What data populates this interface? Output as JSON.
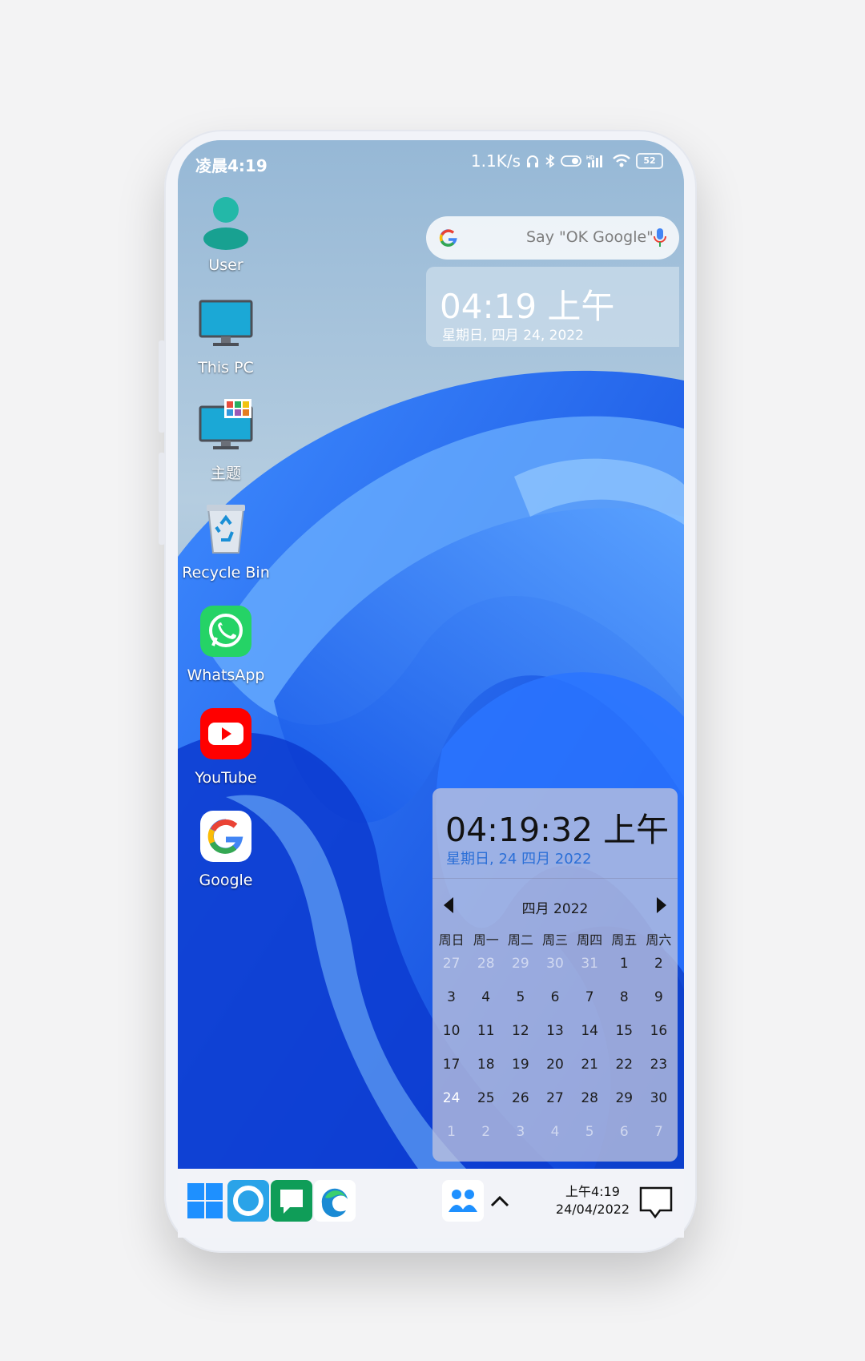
{
  "status_bar": {
    "time": "凌晨4:19",
    "net_speed": "1.1K/s",
    "battery": "52",
    "icons": [
      "headphones-icon",
      "bluetooth-icon",
      "toggle-icon",
      "hd-signal-icon",
      "wifi-icon",
      "battery-icon"
    ]
  },
  "desktop_icons": [
    {
      "label": "User",
      "icon": "user-icon"
    },
    {
      "label": "This PC",
      "icon": "monitor-icon"
    },
    {
      "label": "主题",
      "icon": "theme-icon"
    },
    {
      "label": "Recycle Bin",
      "icon": "recycle-bin-icon"
    },
    {
      "label": "WhatsApp",
      "icon": "whatsapp-icon"
    },
    {
      "label": "YouTube",
      "icon": "youtube-icon"
    },
    {
      "label": "Google",
      "icon": "google-icon"
    }
  ],
  "search": {
    "placeholder": "Say \"OK Google\""
  },
  "clock_widget": {
    "time": "04:19 上午",
    "date": "星期日, 四月 24, 2022"
  },
  "calendar": {
    "time": "04:19:32 上午",
    "date": "星期日, 24 四月 2022",
    "month_title": "四月 2022",
    "weekdays": [
      "周日",
      "周一",
      "周二",
      "周三",
      "周四",
      "周五",
      "周六"
    ],
    "today": "24",
    "weeks": [
      [
        "27",
        "28",
        "29",
        "30",
        "31",
        "1",
        "2"
      ],
      [
        "3",
        "4",
        "5",
        "6",
        "7",
        "8",
        "9"
      ],
      [
        "10",
        "11",
        "12",
        "13",
        "14",
        "15",
        "16"
      ],
      [
        "17",
        "18",
        "19",
        "20",
        "21",
        "22",
        "23"
      ],
      [
        "24",
        "25",
        "26",
        "27",
        "28",
        "29",
        "30"
      ],
      [
        "1",
        "2",
        "3",
        "4",
        "5",
        "6",
        "7"
      ]
    ]
  },
  "taskbar": {
    "items": [
      "windows-start-icon",
      "cortana-icon",
      "messages-icon",
      "edge-icon",
      "people-icon",
      "chevron-up-icon"
    ],
    "time": "上午4:19",
    "date": "24/04/2022"
  },
  "colors": {
    "wallpaper_blue": "#1f6ff0",
    "today_highlight": "#1f72c9",
    "calendar_date_text": "#2b6fd7",
    "taskbar": "#f2f3f8"
  }
}
